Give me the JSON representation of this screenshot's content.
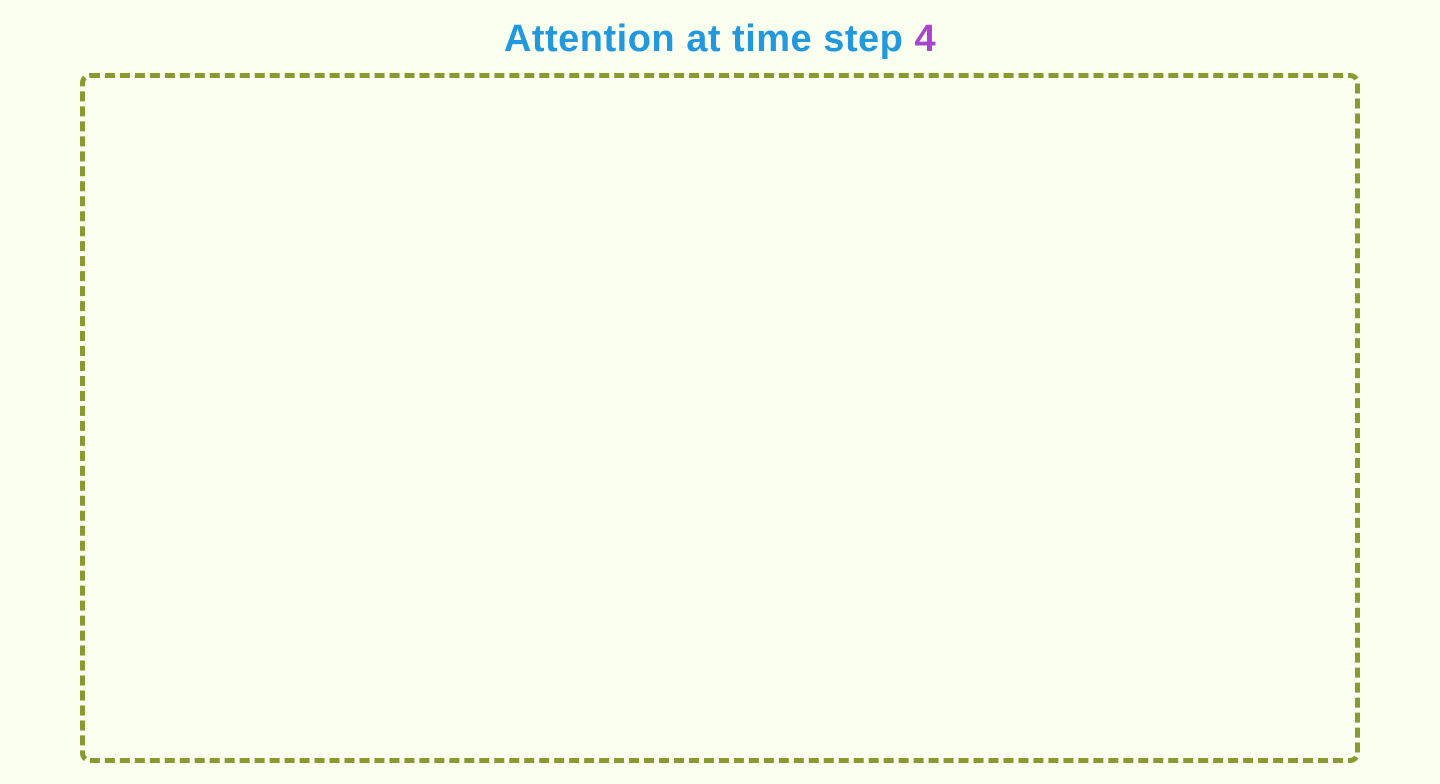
{
  "title": {
    "prefix": "Attention at time step",
    "number": "4",
    "prefix_color": "#2299dd",
    "number_color": "#aa44cc"
  },
  "box": {
    "border_color": "#8a9a30",
    "background_color": "#fafff0"
  }
}
